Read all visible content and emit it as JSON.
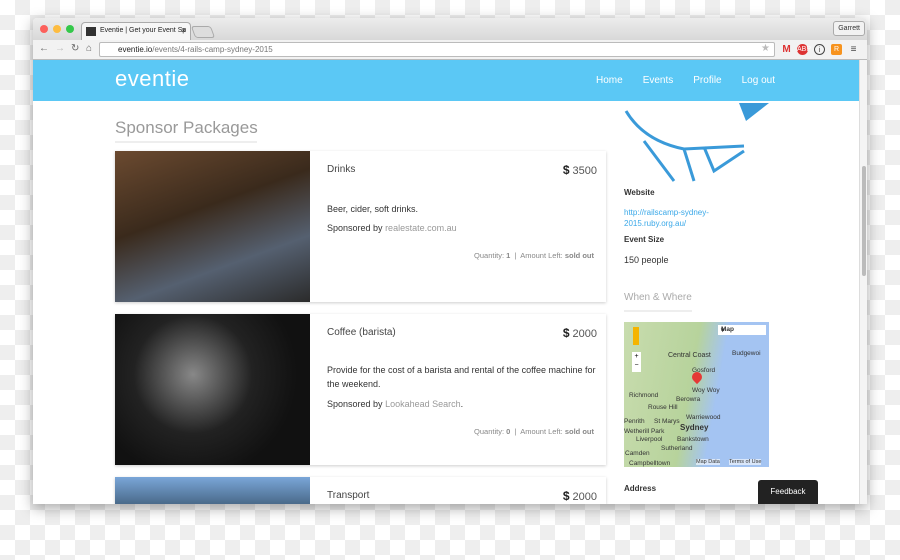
{
  "browser": {
    "tab_title": "Eventie | Get your Event Sp",
    "url_domain": "eventie.io",
    "url_path": "/events/4-rails-camp-sydney-2015",
    "user": "Garrett"
  },
  "nav": {
    "logo": "eventie",
    "items": [
      "Home",
      "Events",
      "Profile",
      "Log out"
    ]
  },
  "main": {
    "heading": "Sponsor Packages",
    "packages": [
      {
        "title": "Drinks",
        "currency": "$",
        "price": "3500",
        "description": "Beer, cider, soft drinks.",
        "sponsored_label": "Sponsored by",
        "sponsor": "realestate.com.au",
        "sponsor_suffix": "",
        "quantity_label": "Quantity:",
        "quantity": "1",
        "amount_left_label": "Amount Left:",
        "amount_left": "sold out"
      },
      {
        "title": "Coffee (barista)",
        "currency": "$",
        "price": "2000",
        "description": "Provide for the cost of a barista and rental of the coffee machine for the weekend.",
        "sponsored_label": "Sponsored by",
        "sponsor": "Lookahead Search",
        "sponsor_suffix": ".",
        "quantity_label": "Quantity:",
        "quantity": "0",
        "amount_left_label": "Amount Left:",
        "amount_left": "sold out"
      },
      {
        "title": "Transport",
        "currency": "$",
        "price": "2000"
      }
    ]
  },
  "sidebar": {
    "website_label": "Website",
    "website_line1": "http://railscamp-sydney-",
    "website_line2": "2015.ruby.org.au/",
    "size_label": "Event Size",
    "size_value": "150 people",
    "when_where": "When & Where",
    "address_label": "Address",
    "map": {
      "type_label": "Map",
      "places": [
        "Central Coast",
        "Budgewoi",
        "Gosford",
        "Woy Woy",
        "Richmond",
        "Berowra",
        "Rouse Hill",
        "St Marys",
        "Warriewood",
        "Penrith",
        "Wetherill Park",
        "Sydney",
        "Liverpool",
        "Bankstown",
        "Sutherland",
        "Camden",
        "Campbelltown"
      ],
      "map_data": "Map Data",
      "terms": "Terms of Use"
    }
  },
  "feedback": "Feedback",
  "colors": {
    "header": "#5bc8f5",
    "link": "#3aa8e8"
  }
}
